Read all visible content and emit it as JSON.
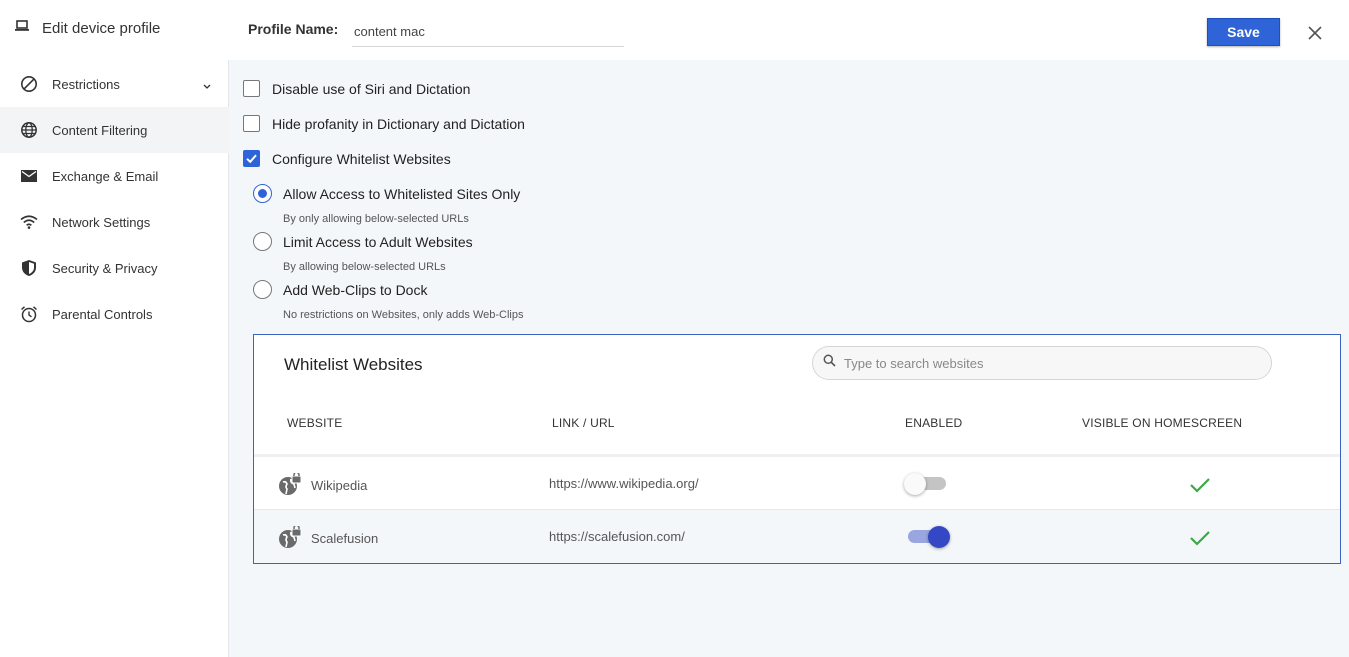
{
  "header": {
    "title": "Edit device profile",
    "profile_name_label": "Profile Name:",
    "profile_name_value": "content mac",
    "save_label": "Save"
  },
  "sidebar": {
    "items": [
      {
        "label": "Restrictions",
        "icon": "block-icon"
      },
      {
        "label": "Content Filtering",
        "icon": "globe-icon"
      },
      {
        "label": "Exchange & Email",
        "icon": "mail-icon"
      },
      {
        "label": "Network Settings",
        "icon": "wifi-icon"
      },
      {
        "label": "Security & Privacy",
        "icon": "shield-icon"
      },
      {
        "label": "Parental Controls",
        "icon": "alarm-clock-icon"
      }
    ],
    "active": "Content Filtering"
  },
  "options": {
    "disable_siri": {
      "label": "Disable use of Siri and Dictation",
      "checked": false
    },
    "hide_profanity": {
      "label": "Hide profanity in Dictionary and Dictation",
      "checked": false
    },
    "configure_whitelist": {
      "label": "Configure Whitelist Websites",
      "checked": true
    }
  },
  "access_modes": [
    {
      "label": "Allow Access to Whitelisted Sites Only",
      "hint": "By only allowing below-selected URLs",
      "selected": true
    },
    {
      "label": "Limit Access to Adult Websites",
      "hint": "By allowing below-selected URLs",
      "selected": false
    },
    {
      "label": "Add Web-Clips to Dock",
      "hint": "No restrictions on Websites, only adds Web-Clips",
      "selected": false
    }
  ],
  "whitelist": {
    "title": "Whitelist Websites",
    "search_placeholder": "Type to search websites",
    "columns": [
      "WEBSITE",
      "LINK / URL",
      "ENABLED",
      "VISIBLE ON HOMESCREEN"
    ],
    "rows": [
      {
        "website": "Wikipedia",
        "url": "https://www.wikipedia.org/",
        "enabled": false,
        "visible_on_homescreen": true
      },
      {
        "website": "Scalefusion",
        "url": "https://scalefusion.com/",
        "enabled": true,
        "visible_on_homescreen": true
      }
    ]
  },
  "colors": {
    "accent": "#2f63d8",
    "toggle_on": "#3447c4",
    "check_green": "#3aa845"
  }
}
